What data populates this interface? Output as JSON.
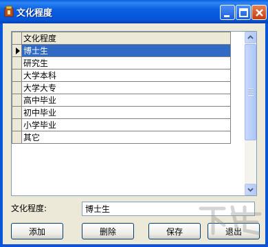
{
  "window": {
    "title": "文化程度"
  },
  "grid": {
    "header": "文化程度",
    "rows": [
      "博士生",
      "研究生",
      "大学本科",
      "大学大专",
      "高中毕业",
      "初中毕业",
      "小学毕业",
      "其它"
    ],
    "selected_index": 0
  },
  "form": {
    "label": "文化程度:",
    "value": "博士生"
  },
  "buttons": {
    "add": "添加",
    "delete": "删除",
    "save": "保存",
    "exit": "退出"
  },
  "colors": {
    "titlebar": "#0a5fe0",
    "selection": "#316ac5",
    "window_bg": "#ece9d8"
  }
}
